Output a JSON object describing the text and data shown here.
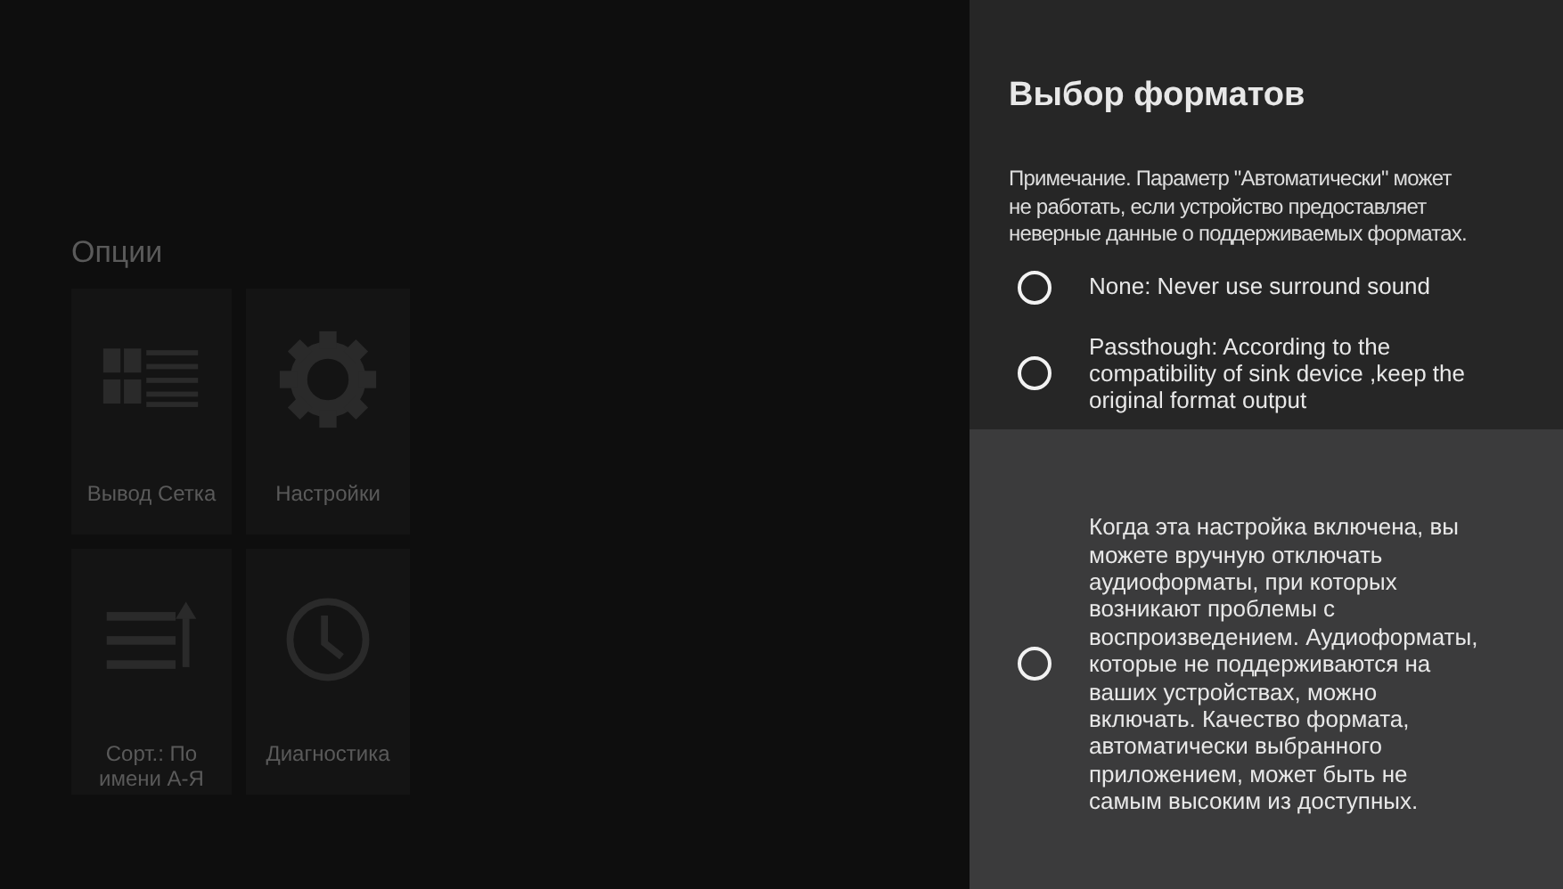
{
  "background": {
    "title": "Опции",
    "tiles": [
      {
        "label": "Вывод Сетка",
        "kind": "grid"
      },
      {
        "label": "Настройки",
        "kind": "gear"
      },
      {
        "label": "Сорт.: По имени А-Я",
        "kind": "sort"
      },
      {
        "label": "Диагностика",
        "kind": "clock"
      }
    ]
  },
  "panel": {
    "title": "Выбор форматов",
    "note": "Примечание. Параметр \"Автоматически\" может не работать, если устройство предоставляет неверные данные о поддерживаемых форматах.",
    "options": [
      {
        "label": "None: Never use surround sound",
        "selected": false,
        "focused": false
      },
      {
        "label": "Passthough: According to the compatibility of sink device ,keep the original format output",
        "selected": false,
        "focused": false
      },
      {
        "label": "Когда эта настройка включена, вы можете вручную отключать аудиоформаты, при которых возникают проблемы с воспроизведением. Аудиоформаты, которые не поддерживаются на ваших устройствах, можно включать. Качество формата, автоматически выбранного приложением, может быть не самым высоким из доступных.",
        "selected": false,
        "focused": true
      }
    ]
  }
}
